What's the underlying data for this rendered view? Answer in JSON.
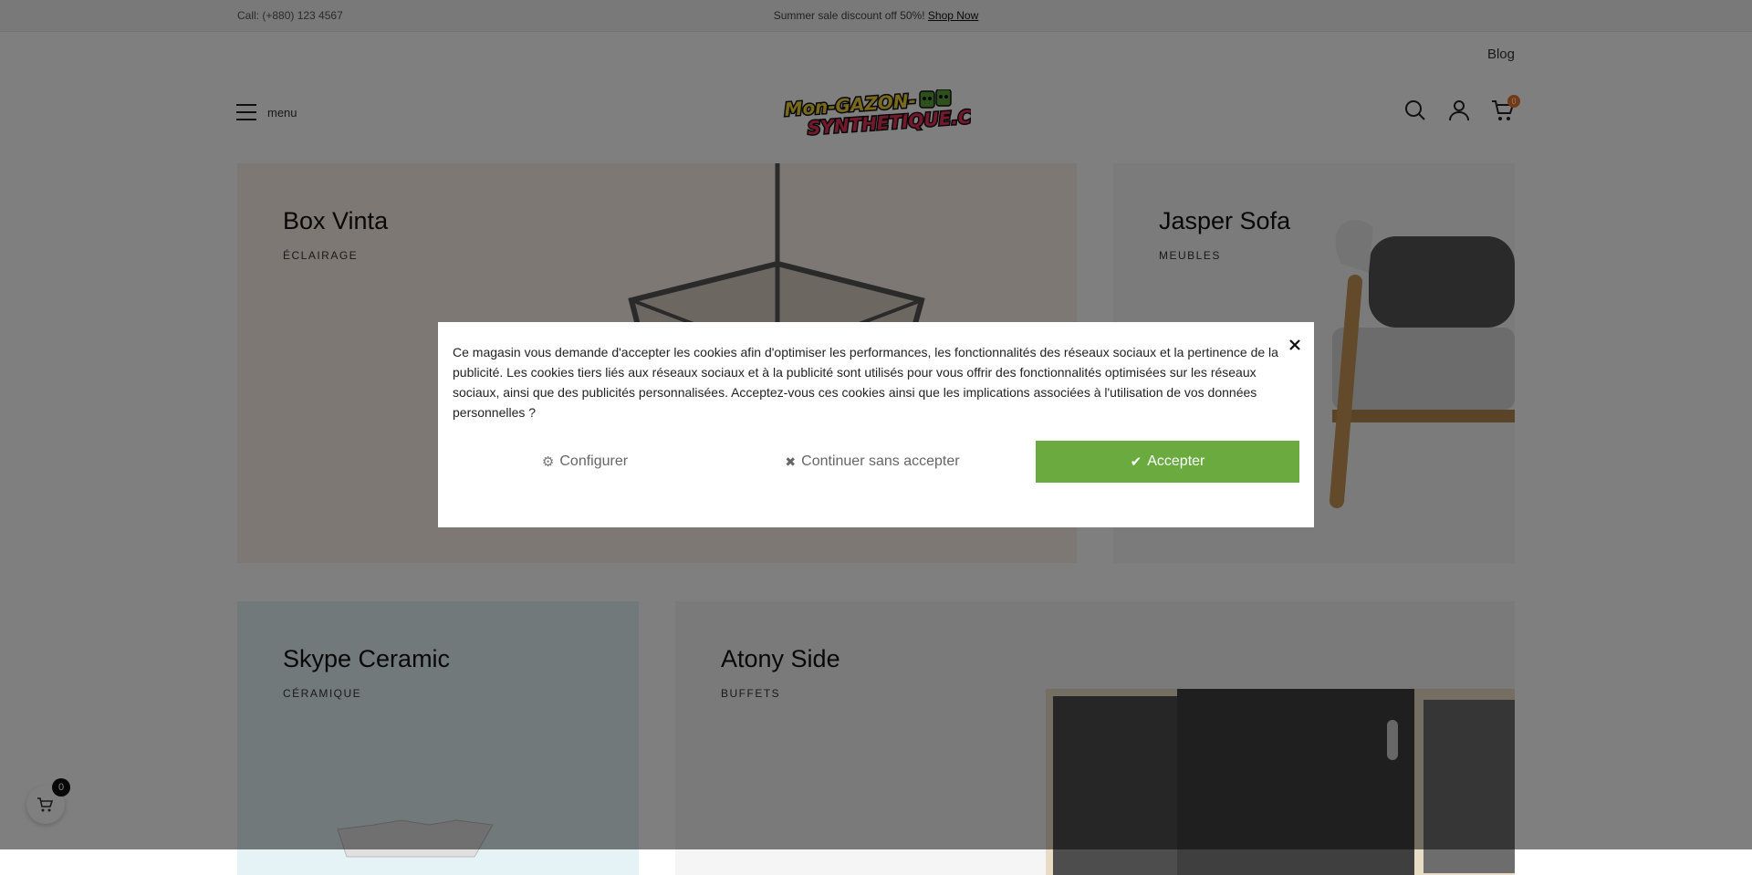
{
  "topbar": {
    "call": "Call: (+880) 123 4567",
    "promo_text": "Summer sale discount off 50%! ",
    "promo_link": "Shop Now"
  },
  "header": {
    "blog": "Blog",
    "menu_label": "menu",
    "logo_line1": "Mon-GAZON-",
    "logo_line2": "SYNTHETIQUE.COM",
    "cart_count": "0"
  },
  "cards": [
    {
      "title": "Box Vinta",
      "category": "ÉCLAIRAGE"
    },
    {
      "title": "Jasper Sofa",
      "category": "MEUBLES"
    },
    {
      "title": "Skype Ceramic",
      "category": "CÉRAMIQUE"
    },
    {
      "title": "Atony Side",
      "category": "BUFFETS"
    }
  ],
  "cookie_modal": {
    "text": "Ce magasin vous demande d'accepter les cookies afin d'optimiser les performances, les fonctionnalités des réseaux sociaux et la pertinence de la publicité. Les cookies tiers liés aux réseaux sociaux et à la publicité sont utilisés pour vous offrir des fonctionnalités optimisées sur les réseaux sociaux, ainsi que des publicités personnalisées. Acceptez-vous ces cookies ainsi que les implications associées à l'utilisation de vos données personnelles ?",
    "configure_label": "Configurer",
    "continue_label": "Continuer sans accepter",
    "accept_label": "Accepter",
    "accept_color": "#6aaa3f"
  },
  "floating_cart": {
    "count": "0"
  },
  "colors": {
    "accent_orange": "#e8732c",
    "overlay": "rgba(0,0,0,0.5)"
  }
}
